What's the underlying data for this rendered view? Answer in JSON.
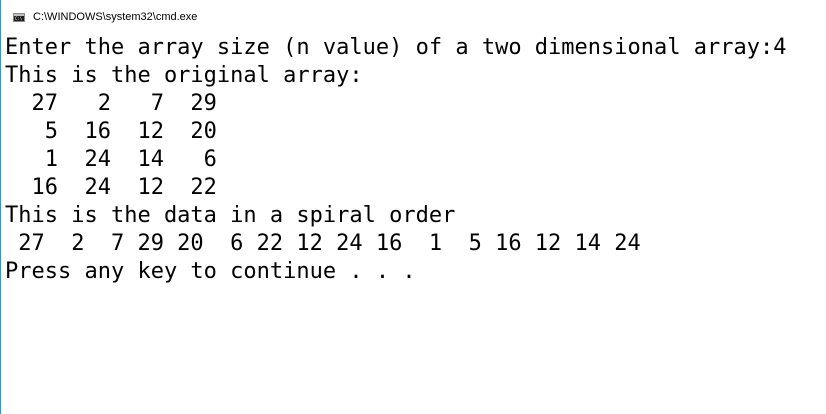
{
  "window": {
    "title": "C:\\WINDOWS\\system32\\cmd.exe",
    "icon": "cmd-console-icon"
  },
  "console": {
    "lines": [
      "Enter the array size (n value) of a two dimensional array:4",
      "This is the original array:",
      "  27   2   7  29",
      "   5  16  12  20",
      "   1  24  14   6",
      "  16  24  12  22",
      "This is the data in a spiral order",
      " 27  2  7 29 20  6 22 12 24 16  1  5 16 12 14 24",
      "Press any key to continue . . ."
    ]
  }
}
